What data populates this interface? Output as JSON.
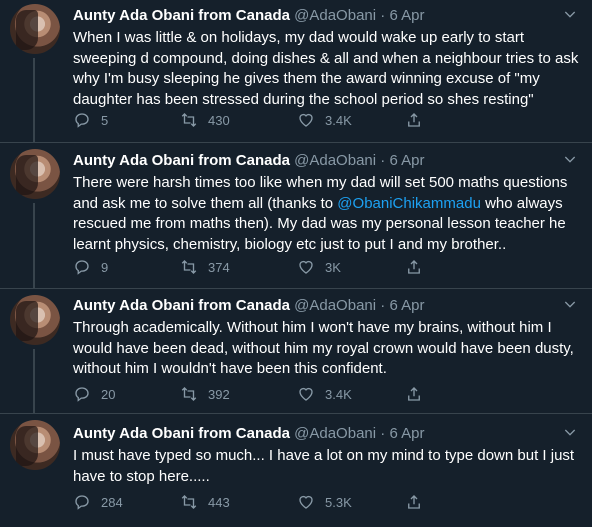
{
  "tweets": [
    {
      "name": "Aunty Ada Obani from Canada",
      "handle": "@AdaObani",
      "dot": "·",
      "date": "6 Apr",
      "text": "When I was little & on holidays, my dad would wake up early to start sweeping d compound, doing dishes & all and when a neighbour tries to ask why I'm busy sleeping he gives them the award winning excuse of \"my daughter has been stressed during the school period so shes resting\"",
      "replies": "5",
      "retweets": "430",
      "likes": "3.4K"
    },
    {
      "name": "Aunty Ada Obani from Canada",
      "handle": "@AdaObani",
      "dot": "·",
      "date": "6 Apr",
      "text_before": "There were harsh times too like when my dad will set 500 maths questions and ask me to solve them all (thanks to ",
      "mention": "@ObaniChikammadu",
      "text_after": " who always rescued me from maths then). My dad was my personal lesson teacher he learnt physics, chemistry, biology etc just to put I and my brother..",
      "replies": "9",
      "retweets": "374",
      "likes": "3K"
    },
    {
      "name": "Aunty Ada Obani from Canada",
      "handle": "@AdaObani",
      "dot": "·",
      "date": "6 Apr",
      "text": "Through academically. Without him I won't have my brains, without him I would have been dead, without him my royal crown would have been dusty, without him I wouldn't have been this confident.",
      "replies": "20",
      "retweets": "392",
      "likes": "3.4K"
    },
    {
      "name": "Aunty Ada Obani from Canada",
      "handle": "@AdaObani",
      "dot": "·",
      "date": "6 Apr",
      "text": "I must have typed so much... I have a lot on my mind to type down but I just have to stop here.....",
      "replies": "284",
      "retweets": "443",
      "likes": "5.3K"
    }
  ],
  "icons": {
    "reply": "reply-icon",
    "retweet": "retweet-icon",
    "like": "heart-icon",
    "share": "share-icon",
    "caret": "chevron-down-icon"
  },
  "colors": {
    "background": "#15202b",
    "secondary_text": "#8899a6",
    "link": "#1da1f2",
    "divider": "#38444d"
  }
}
